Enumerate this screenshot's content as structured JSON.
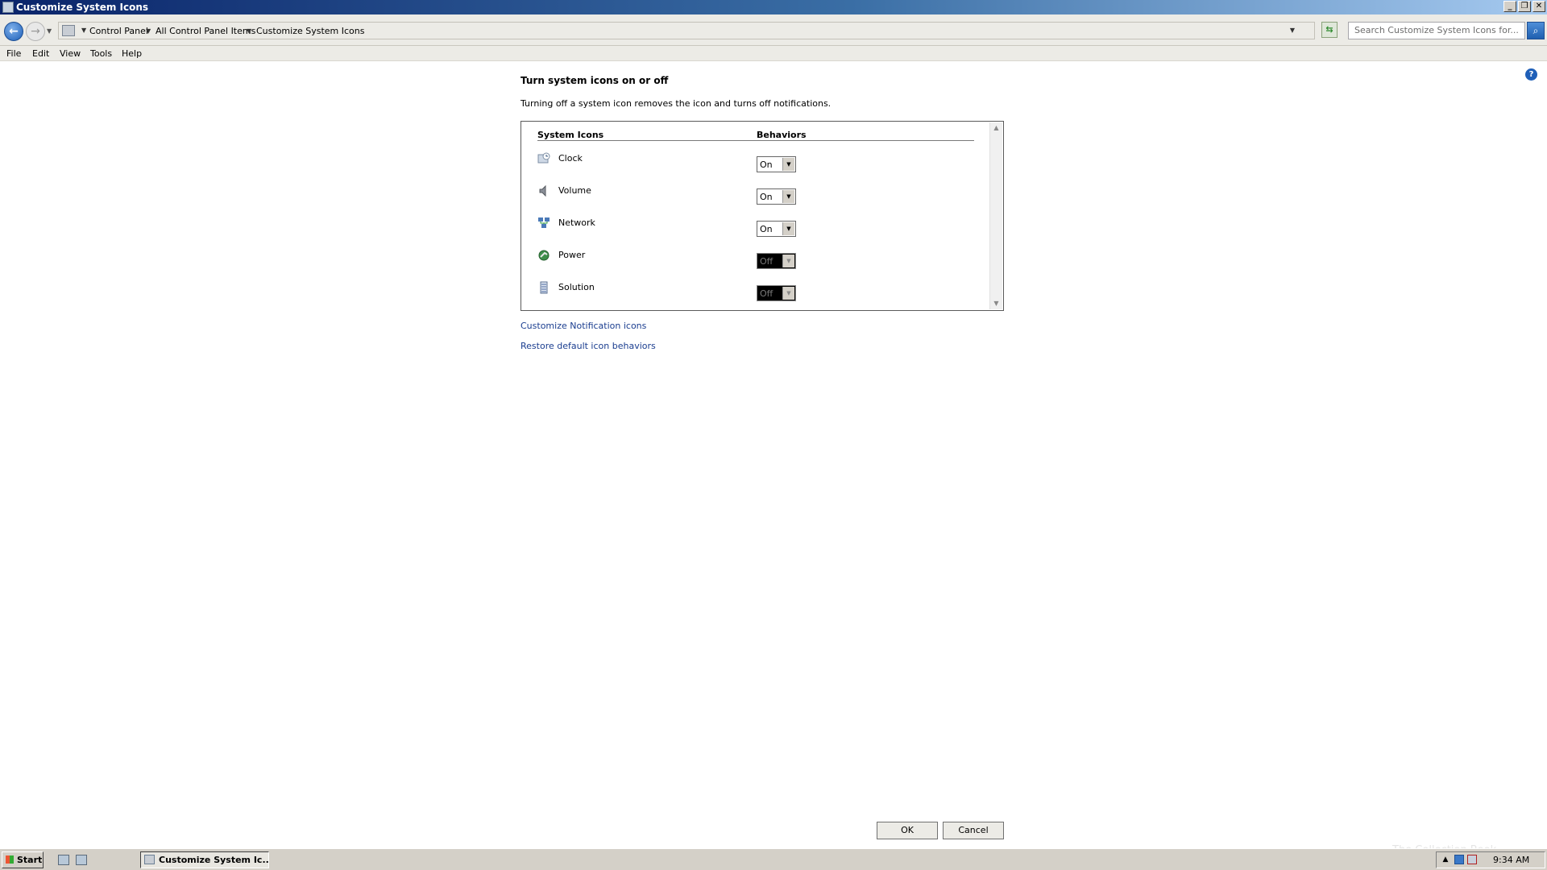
{
  "window": {
    "title": "Customize System Icons",
    "controls": [
      "_",
      "❐",
      "✕"
    ]
  },
  "address": {
    "crumbs": [
      "Control Panel",
      "All Control Panel Items",
      "Customize System Icons"
    ],
    "search_placeholder": "Search Customize System Icons for..."
  },
  "menu": [
    "File",
    "Edit",
    "View",
    "Tools",
    "Help"
  ],
  "content": {
    "heading": "Turn system icons on or off",
    "description": "Turning off a system icon removes the icon and turns off notifications.",
    "col_icons": "System Icons",
    "col_behaviors": "Behaviors",
    "rows": [
      {
        "name": "Clock",
        "icon": "clock-icon",
        "value": "On",
        "enabled": true
      },
      {
        "name": "Volume",
        "icon": "volume-icon",
        "value": "On",
        "enabled": true
      },
      {
        "name": "Network",
        "icon": "network-icon",
        "value": "On",
        "enabled": true
      },
      {
        "name": "Power",
        "icon": "power-icon",
        "value": "Off",
        "enabled": false
      },
      {
        "name": "Solution",
        "icon": "action-center-icon",
        "value": "Off",
        "enabled": false
      }
    ],
    "link_customize": "Customize Notification icons",
    "link_restore": "Restore default icon behaviors"
  },
  "buttons": {
    "ok": "OK",
    "cancel": "Cancel"
  },
  "taskbar": {
    "start": "Start",
    "task": "Customize System Ic...",
    "clock": "9:34 AM"
  },
  "watermark": "The Collection Book",
  "colors": {
    "link": "#1a3d8f",
    "titlebar": "#0a246a",
    "disabled_select": "#000000"
  }
}
